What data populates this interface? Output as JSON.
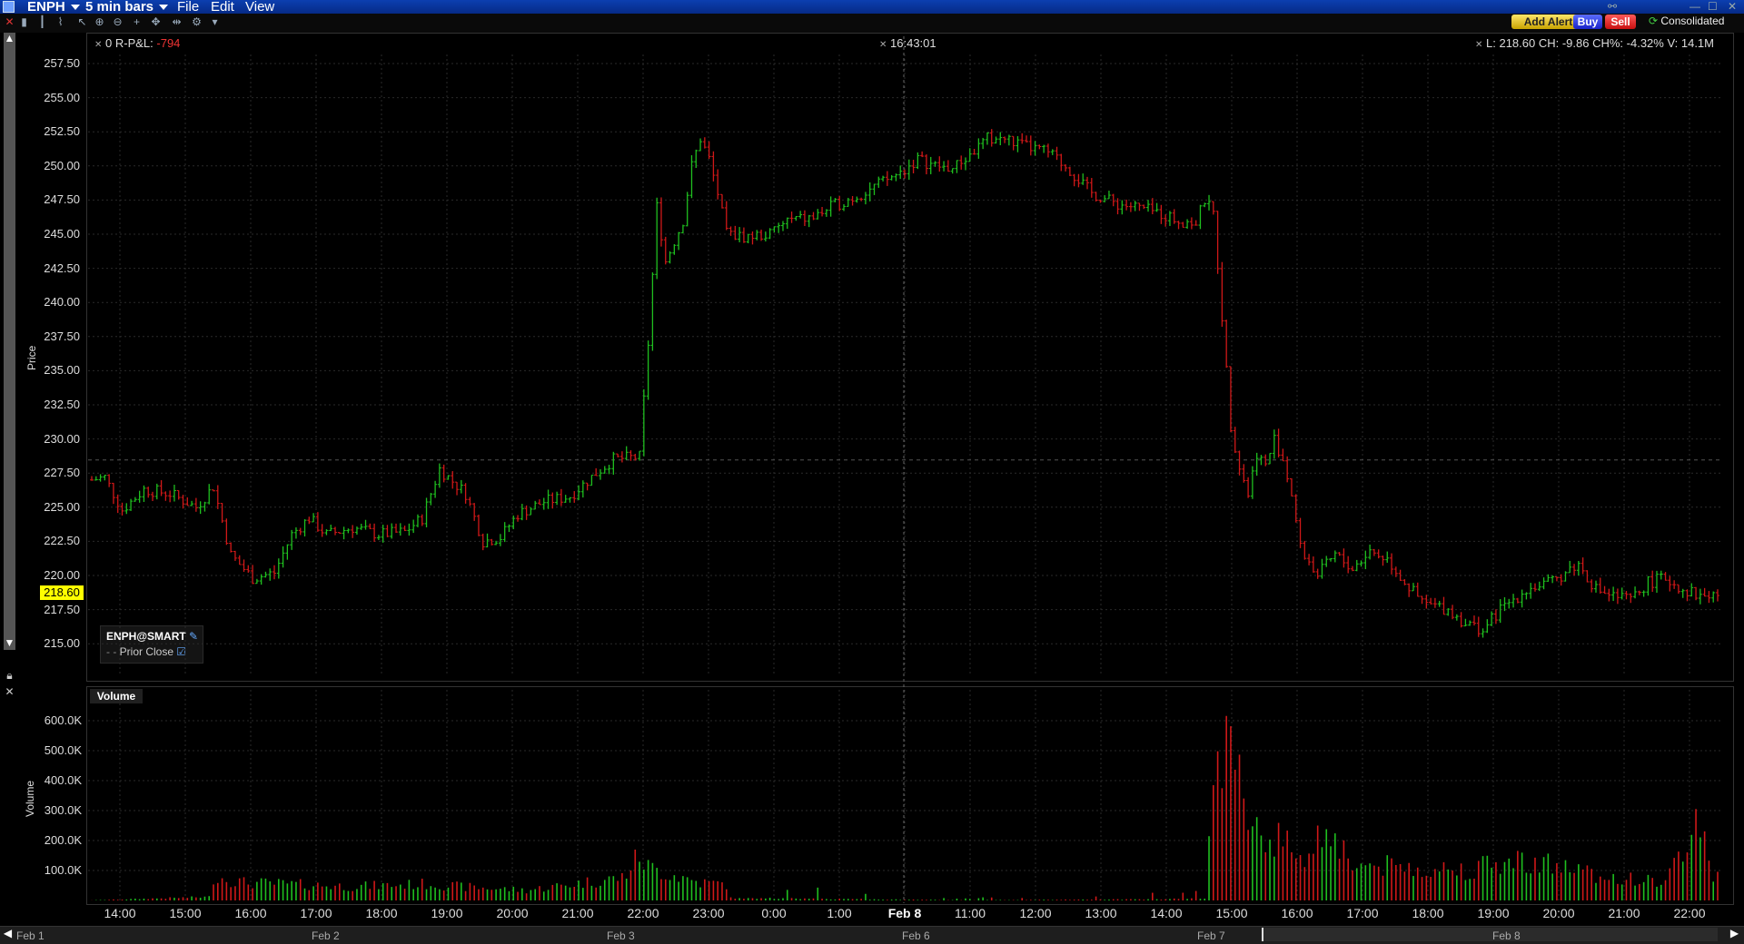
{
  "titlebar": {
    "symbol": "ENPH",
    "interval": "5 min bars",
    "menus": [
      "File",
      "Edit",
      "View"
    ]
  },
  "toolbar": {
    "add_alert_label": "Add Alert",
    "buy_label": "Buy",
    "sell_label": "Sell",
    "feed_label": "Consolidated"
  },
  "header": {
    "rpnl_prefix": "0 R-P&L:",
    "rpnl_value": "-794",
    "time": "16:43:01",
    "summary": "L: 218.60 CH: -9.86 CH%: -4.32% V: 14.1M"
  },
  "legend": {
    "contract": "ENPH@SMART",
    "prior_close": "Prior Close"
  },
  "price_axis": {
    "title": "Price",
    "ticks": [
      "257.50",
      "255.00",
      "252.50",
      "250.00",
      "247.50",
      "245.00",
      "242.50",
      "240.00",
      "237.50",
      "235.00",
      "232.50",
      "230.00",
      "227.50",
      "225.00",
      "222.50",
      "220.00",
      "217.50",
      "215.00"
    ],
    "last_price": "218.60"
  },
  "volume_axis": {
    "title": "Volume",
    "panel_label": "Volume",
    "ticks": [
      "600.0K",
      "500.0K",
      "400.0K",
      "300.0K",
      "200.0K",
      "100.0K"
    ]
  },
  "time_axis": {
    "ticks": [
      "14:00",
      "15:00",
      "16:00",
      "17:00",
      "18:00",
      "19:00",
      "20:00",
      "21:00",
      "22:00",
      "23:00",
      "0:00",
      "1:00",
      "Feb 8",
      "11:00",
      "12:00",
      "13:00",
      "14:00",
      "15:00",
      "16:00",
      "17:00",
      "18:00",
      "19:00",
      "20:00",
      "21:00",
      "22:00"
    ],
    "bold_tick": "Feb 8"
  },
  "overview_dates": [
    "Feb 1",
    "Feb 2",
    "Feb 3",
    "Feb 6",
    "Feb 7",
    "Feb 8"
  ],
  "colors": {
    "up": "#1fbf1f",
    "down": "#d01818",
    "background": "#000000",
    "grid": "#2a2a2a",
    "price_tag": "#ffff00"
  },
  "chart_data": {
    "type": "ohlc",
    "series_label": "ENPH@SMART",
    "ylabel": "Price",
    "ylim": [
      214.0,
      258.5
    ],
    "prior_close": 228.46,
    "price_path": [
      [
        0,
        227.0
      ],
      [
        3,
        227.2
      ],
      [
        7,
        224.8
      ],
      [
        12,
        226.3
      ],
      [
        18,
        226.0
      ],
      [
        24,
        225.0
      ],
      [
        28,
        226.5
      ],
      [
        32,
        221.5
      ],
      [
        37,
        219.8
      ],
      [
        42,
        220.2
      ],
      [
        46,
        223.0
      ],
      [
        50,
        224.2
      ],
      [
        54,
        223.0
      ],
      [
        60,
        223.5
      ],
      [
        66,
        223.0
      ],
      [
        72,
        223.2
      ],
      [
        76,
        224.2
      ],
      [
        80,
        227.8
      ],
      [
        86,
        226.0
      ],
      [
        90,
        222.5
      ],
      [
        94,
        222.8
      ],
      [
        98,
        224.5
      ],
      [
        104,
        225.4
      ],
      [
        110,
        225.8
      ],
      [
        116,
        227.5
      ],
      [
        120,
        228.5
      ],
      [
        126,
        228.7
      ],
      [
        128,
        237.0
      ],
      [
        130,
        247.0
      ],
      [
        132,
        243.0
      ],
      [
        136,
        246.0
      ],
      [
        138,
        250.0
      ],
      [
        140,
        252.0
      ],
      [
        142,
        250.5
      ],
      [
        144,
        248.0
      ],
      [
        146,
        245.0
      ],
      [
        150,
        244.8
      ],
      [
        156,
        245.0
      ],
      [
        160,
        246.0
      ],
      [
        166,
        246.2
      ],
      [
        170,
        247.0
      ],
      [
        176,
        247.8
      ],
      [
        180,
        248.5
      ],
      [
        186,
        249.5
      ],
      [
        190,
        250.5
      ],
      [
        194,
        250.0
      ],
      [
        198,
        249.8
      ],
      [
        202,
        250.8
      ],
      [
        206,
        252.0
      ],
      [
        210,
        252.0
      ],
      [
        214,
        251.5
      ],
      [
        220,
        251.0
      ],
      [
        224,
        250.0
      ],
      [
        230,
        248.0
      ],
      [
        236,
        247.2
      ],
      [
        240,
        247.0
      ],
      [
        246,
        246.5
      ],
      [
        250,
        246.0
      ],
      [
        254,
        245.8
      ],
      [
        256,
        247.5
      ],
      [
        258,
        246.5
      ],
      [
        260,
        239.0
      ],
      [
        262,
        231.0
      ],
      [
        264,
        228.0
      ],
      [
        266,
        226.0
      ],
      [
        268,
        229.0
      ],
      [
        270,
        228.0
      ],
      [
        272,
        230.0
      ],
      [
        274,
        228.5
      ],
      [
        276,
        226.0
      ],
      [
        278,
        222.0
      ],
      [
        282,
        220.0
      ],
      [
        286,
        221.5
      ],
      [
        290,
        220.5
      ],
      [
        294,
        221.8
      ],
      [
        298,
        221.2
      ],
      [
        302,
        219.5
      ],
      [
        306,
        218.0
      ],
      [
        312,
        217.5
      ],
      [
        316,
        216.5
      ],
      [
        320,
        216.0
      ],
      [
        324,
        217.5
      ],
      [
        330,
        219.0
      ],
      [
        336,
        219.5
      ],
      [
        340,
        220.5
      ],
      [
        342,
        220.8
      ],
      [
        346,
        219.0
      ],
      [
        350,
        218.5
      ],
      [
        354,
        218.2
      ],
      [
        358,
        219.5
      ],
      [
        362,
        219.8
      ],
      [
        366,
        219.0
      ],
      [
        370,
        218.5
      ],
      [
        374,
        218.6
      ]
    ],
    "volume_peaks": [
      [
        0,
        4
      ],
      [
        28,
        95
      ],
      [
        35,
        70
      ],
      [
        60,
        55
      ],
      [
        78,
        65
      ],
      [
        84,
        55
      ],
      [
        100,
        40
      ],
      [
        122,
        90
      ],
      [
        126,
        175
      ],
      [
        128,
        130
      ],
      [
        140,
        70
      ],
      [
        200,
        8
      ],
      [
        246,
        30
      ],
      [
        256,
        60
      ],
      [
        260,
        680
      ],
      [
        262,
        530
      ],
      [
        264,
        500
      ],
      [
        266,
        400
      ],
      [
        268,
        300
      ],
      [
        270,
        260
      ],
      [
        278,
        190
      ],
      [
        280,
        170
      ],
      [
        284,
        310
      ],
      [
        290,
        140
      ],
      [
        300,
        130
      ],
      [
        316,
        120
      ],
      [
        330,
        160
      ],
      [
        350,
        90
      ],
      [
        362,
        70
      ],
      [
        370,
        330
      ],
      [
        373,
        90
      ]
    ]
  }
}
